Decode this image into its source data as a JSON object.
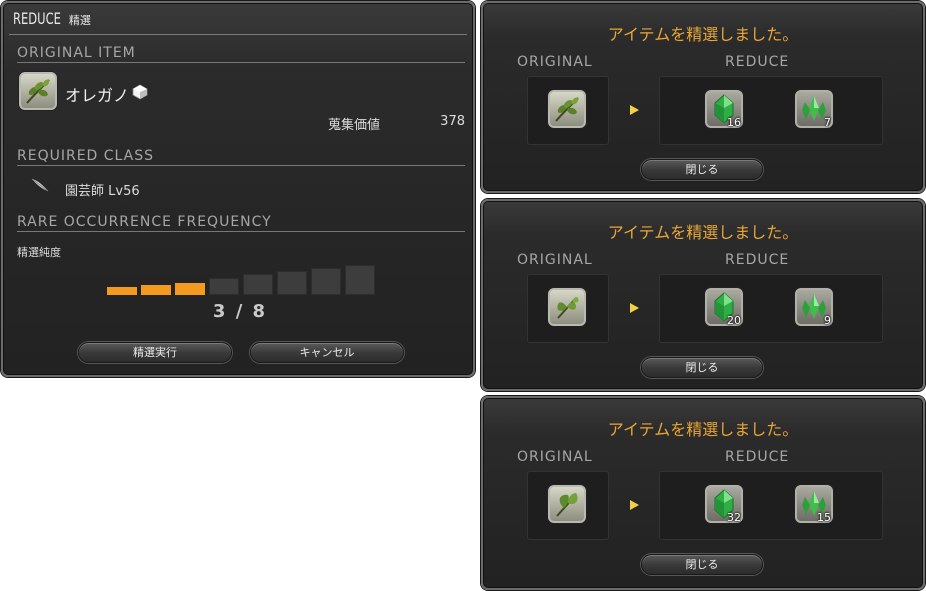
{
  "reduce_window": {
    "title": "REDUCE",
    "title_jp": "精選",
    "original_item_heading": "ORIGINAL ITEM",
    "item_name": "オレガノ",
    "item_icon": "oregano-leaf-icon",
    "collectability_label": "蒐集価値",
    "collectability_value": "378",
    "required_class_heading": "REQUIRED CLASS",
    "class_icon": "botanist-feather-icon",
    "class_text": "園芸師 Lv56",
    "rare_heading": "RARE OCCURRENCE FREQUENCY",
    "purity_label": "精選純度",
    "purity_filled": 3,
    "purity_total": 8,
    "purity_text": "3 / 8",
    "confirm_button": "精選実行",
    "cancel_button": "キャンセル"
  },
  "results": [
    {
      "message": "アイテムを精選しました。",
      "original_label": "ORIGINAL",
      "reduce_label": "REDUCE",
      "original_icon": "oregano-leaf-icon",
      "crystal_qty": "16",
      "cluster_qty": "7",
      "close_button": "閉じる"
    },
    {
      "message": "アイテムを精選しました。",
      "original_label": "ORIGINAL",
      "reduce_label": "REDUCE",
      "original_icon": "herb-leaf-icon",
      "crystal_qty": "20",
      "cluster_qty": "9",
      "close_button": "閉じる"
    },
    {
      "message": "アイテムを精選しました。",
      "original_label": "ORIGINAL",
      "reduce_label": "REDUCE",
      "original_icon": "bay-leaf-icon",
      "crystal_qty": "32",
      "cluster_qty": "15",
      "close_button": "閉じる"
    }
  ],
  "colors": {
    "accent_orange": "#f39a1f",
    "title_gold": "#eaa636",
    "arrow_yellow": "#f1d245",
    "crystal_green": "#3fbf4a"
  }
}
